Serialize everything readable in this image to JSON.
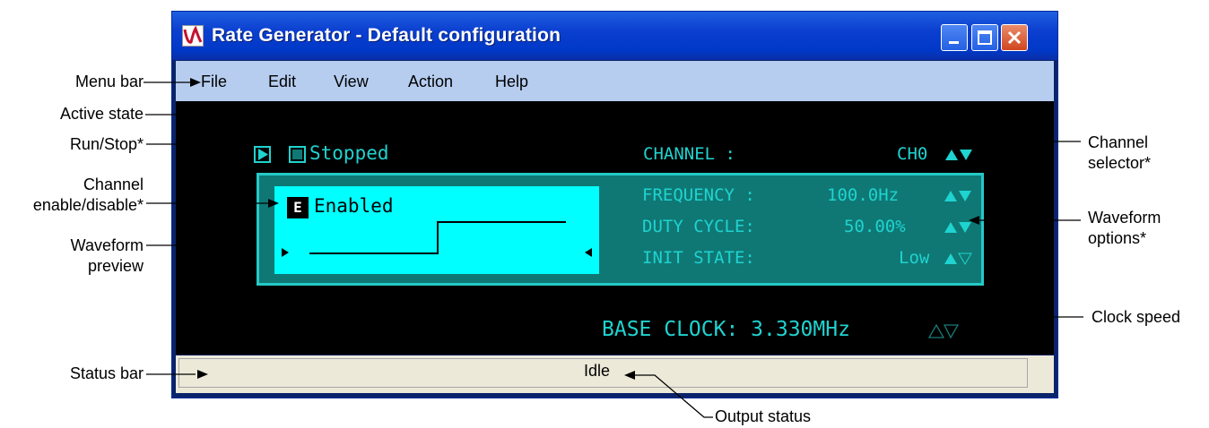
{
  "window": {
    "title": "Rate Generator - Default configuration",
    "colors": {
      "titlebar": "#0b3fcf",
      "lcd_text": "#1fd3d0",
      "panel": "#0f7874",
      "preview": "#00ffff"
    }
  },
  "menu": [
    "File",
    "Edit",
    "View",
    "Action",
    "Help"
  ],
  "display": {
    "active_state": "Stopped",
    "channel_label": "CHANNEL   :",
    "channel_value": "CH0",
    "enable_badge": "E",
    "enable_text": "Enabled",
    "frequency_label": "FREQUENCY :",
    "frequency_value": "100.0Hz",
    "duty_label": "DUTY CYCLE:",
    "duty_value": "50.00%",
    "init_label": "INIT STATE:",
    "init_value": "Low",
    "base_clock": "BASE CLOCK: 3.330MHz"
  },
  "status": {
    "text": "Idle"
  },
  "annotations": {
    "menu_bar": "Menu bar",
    "active_state": "Active state",
    "run_stop": "Run/Stop*",
    "channel_enable": [
      "Channel",
      "enable/disable*"
    ],
    "waveform_preview": [
      "Waveform",
      "preview"
    ],
    "status_bar": "Status bar",
    "channel_selector": [
      "Channel",
      "selector*"
    ],
    "waveform_options": [
      "Waveform",
      "options*"
    ],
    "clock_speed": "Clock speed",
    "output_status": "Output status"
  }
}
